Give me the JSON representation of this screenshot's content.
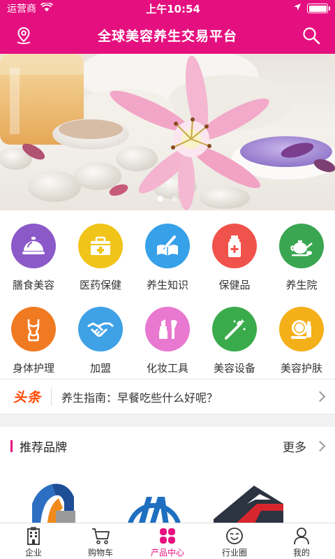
{
  "status_bar": {
    "carrier": "运营商",
    "time": "上午10:54"
  },
  "header": {
    "title": "全球美容养生交易平台"
  },
  "icons": {
    "location": "location-pin-icon",
    "search": "search-icon"
  },
  "colors": {
    "brand": "#e5107f",
    "headline_tag": "#ff4800"
  },
  "banner": {
    "slide_count": 2,
    "active_slide": 1
  },
  "categories": [
    {
      "label": "膳食美容",
      "icon": "food-cloche-icon",
      "color": "#8b59c8"
    },
    {
      "label": "医药保健",
      "icon": "medical-kit-icon",
      "color": "#f0c419"
    },
    {
      "label": "养生知识",
      "icon": "book-pen-icon",
      "color": "#36a0e8"
    },
    {
      "label": "保健品",
      "icon": "medicine-bottle-icon",
      "color": "#f0534b"
    },
    {
      "label": "养生院",
      "icon": "teapot-icon",
      "color": "#3aa651"
    },
    {
      "label": "身体护理",
      "icon": "body-icon",
      "color": "#f07a22"
    },
    {
      "label": "加盟",
      "icon": "handshake-icon",
      "color": "#3fa1e6"
    },
    {
      "label": "化妆工具",
      "icon": "lipstick-brush-icon",
      "color": "#e878d0"
    },
    {
      "label": "美容设备",
      "icon": "magic-wand-icon",
      "color": "#3aab4a"
    },
    {
      "label": "美容护肤",
      "icon": "compact-lipstick-icon",
      "color": "#f4b019"
    }
  ],
  "headline": {
    "tag": "头条",
    "text": "养生指南：早餐吃些什么好呢？"
  },
  "brands": {
    "title": "推荐品牌",
    "more": "更多"
  },
  "tabs": [
    {
      "label": "企业",
      "icon": "building-icon",
      "active": false
    },
    {
      "label": "购物车",
      "icon": "cart-icon",
      "active": false
    },
    {
      "label": "产品中心",
      "icon": "grid-petals-icon",
      "active": true
    },
    {
      "label": "行业圈",
      "icon": "smiley-icon",
      "active": false
    },
    {
      "label": "我的",
      "icon": "user-icon",
      "active": false
    }
  ]
}
